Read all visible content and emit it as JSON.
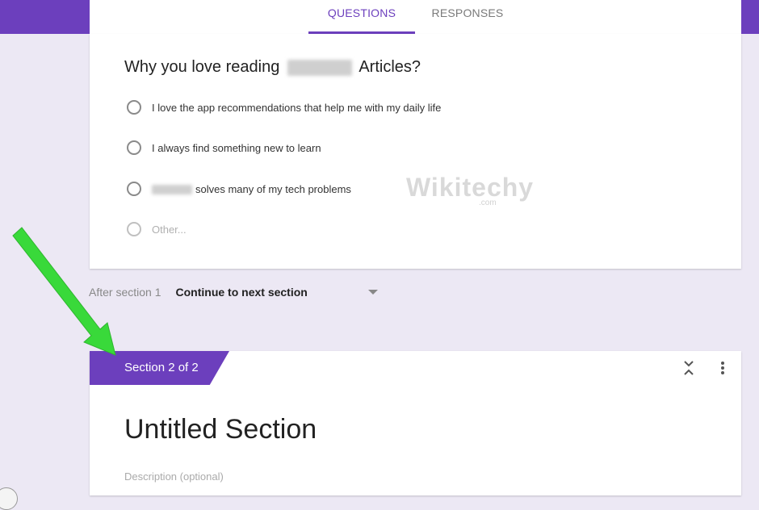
{
  "tabs": [
    {
      "label": "QUESTIONS",
      "active": true
    },
    {
      "label": "RESPONSES",
      "active": false
    }
  ],
  "question": {
    "title_start": "Why you love reading",
    "title_end": "Articles?",
    "options": [
      {
        "label": "I love the app recommendations that help me with my daily life"
      },
      {
        "label": "I always find something new to learn"
      },
      {
        "label": "solves many of my tech problems"
      },
      {
        "label": "Other..."
      }
    ]
  },
  "watermark": {
    "text": "Wikitechy",
    "sub": ".com"
  },
  "after_section": {
    "label": "After section 1",
    "value": "Continue to next section"
  },
  "section": {
    "tab_label": "Section 2 of 2",
    "title": "Untitled Section",
    "description_placeholder": "Description (optional)"
  },
  "colors": {
    "accent": "#6c3fbd",
    "background": "#ece8f4",
    "arrow": "#39d93a"
  },
  "icons": [
    "radio-unchecked-icon",
    "dropdown-arrow-icon",
    "collapse-icon",
    "more-vert-icon",
    "green-arrow"
  ]
}
